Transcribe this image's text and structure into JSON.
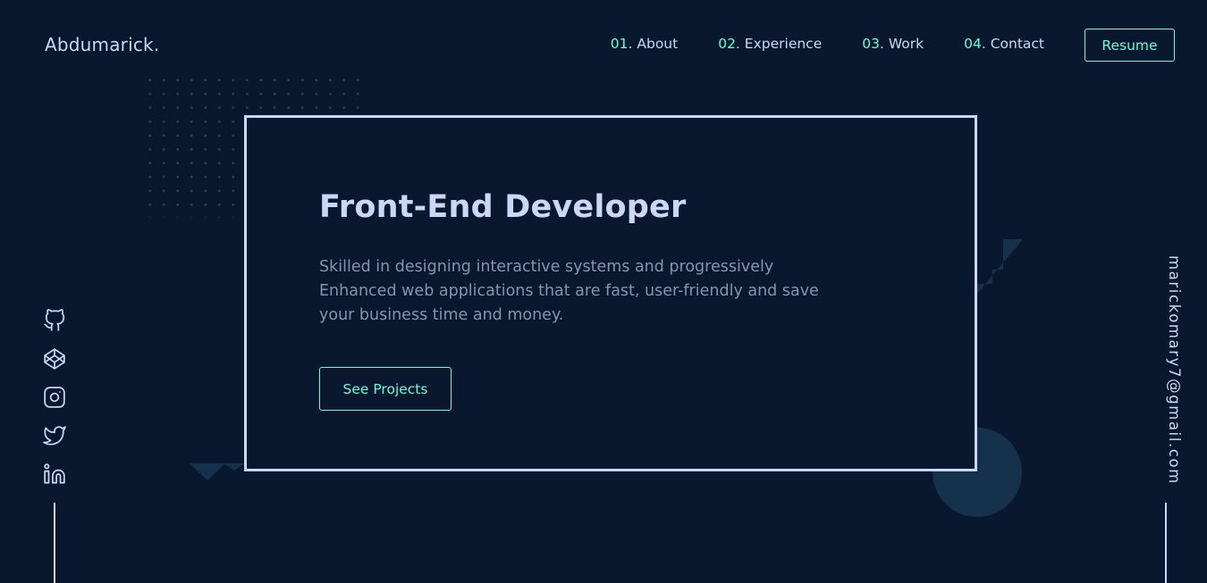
{
  "logo": "Abdumarick.",
  "nav": [
    {
      "num": "01.",
      "label": "About"
    },
    {
      "num": "02.",
      "label": "Experience"
    },
    {
      "num": "03.",
      "label": "Work"
    },
    {
      "num": "04.",
      "label": "Contact"
    }
  ],
  "resume_label": "Resume",
  "hero": {
    "title": "Front-End Developer",
    "description": "Skilled in designing interactive systems and progressively Enhanced web applications that are fast, user-friendly and save your business time and money.",
    "cta_label": "See Projects"
  },
  "social_icons": [
    "github-icon",
    "codepen-icon",
    "instagram-icon",
    "twitter-icon",
    "linkedin-icon"
  ],
  "email": "marickomary7@gmail.com",
  "colors": {
    "background": "#0a182f",
    "accent": "#64ffda",
    "light_text": "#ccd6f6",
    "muted_text": "#8892b0"
  }
}
